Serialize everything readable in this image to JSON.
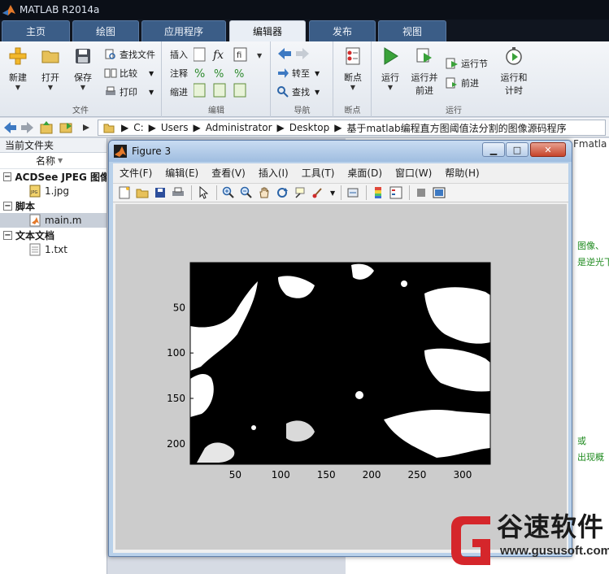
{
  "app": {
    "title": "MATLAB R2014a"
  },
  "tabs": [
    {
      "label": "主页"
    },
    {
      "label": "绘图"
    },
    {
      "label": "应用程序"
    },
    {
      "label": "编辑器",
      "active": true
    },
    {
      "label": "发布"
    },
    {
      "label": "视图"
    }
  ],
  "ribbon": {
    "file_group": {
      "label": "文件",
      "new": "新建",
      "open": "打开",
      "save": "保存",
      "find_files": "查找文件",
      "compare": "比较",
      "print": "打印"
    },
    "edit_group": {
      "label": "编辑",
      "insert": "插入",
      "comment": "注释",
      "indent": "缩进"
    },
    "nav_group": {
      "label": "导航",
      "goto": "转至",
      "find": "查找"
    },
    "bp_group": {
      "label": "断点",
      "breakpoints": "断点"
    },
    "run_group": {
      "label": "运行",
      "run": "运行",
      "run_advance_l1": "运行并",
      "run_advance_l2": "前进",
      "run_section": "运行节",
      "advance": "前进",
      "run_time_l1": "运行和",
      "run_time_l2": "计时"
    }
  },
  "address": {
    "segments": [
      "C:",
      "Users",
      "Administrator",
      "Desktop",
      "基于matlab编程直方图阈值法分割的图像源码程序"
    ]
  },
  "current_folder": {
    "title": "当前文件夹",
    "column_name": "名称",
    "groups": [
      {
        "label": "ACDSee JPEG 图像",
        "files": [
          {
            "name": "1.jpg",
            "icon": "jpeg-file-icon"
          }
        ]
      },
      {
        "label": "脚本",
        "files": [
          {
            "name": "main.m",
            "icon": "matlab-script-icon",
            "selected": true
          }
        ]
      },
      {
        "label": "文本文档",
        "files": [
          {
            "name": "1.txt",
            "icon": "text-file-icon"
          }
        ]
      }
    ]
  },
  "background_editor": {
    "tab_fragment": "Fmatla",
    "comment_1": "图像、",
    "comment_2": "是逆光下",
    "comment_3": "或",
    "comment_4": "出现概"
  },
  "figure": {
    "title": "Figure 3",
    "menu": [
      "文件(F)",
      "编辑(E)",
      "查看(V)",
      "插入(I)",
      "工具(T)",
      "桌面(D)",
      "窗口(W)",
      "帮助(H)"
    ],
    "toolbar_icons": [
      "new-figure-icon",
      "open-icon",
      "save-icon",
      "print-icon",
      "pointer-icon",
      "zoom-in-icon",
      "zoom-out-icon",
      "pan-icon",
      "rotate-icon",
      "data-cursor-icon",
      "brush-icon",
      "link-icon",
      "colorbar-icon",
      "legend-icon",
      "hide-plot-tools-icon",
      "show-plot-tools-icon"
    ],
    "axes": {
      "xticks": [
        "50",
        "100",
        "150",
        "200",
        "250",
        "300"
      ],
      "yticks": [
        "50",
        "100",
        "150",
        "200"
      ],
      "xlim": [
        0.5,
        330.5
      ],
      "ylim": [
        0.5,
        222.5
      ]
    }
  },
  "watermark": {
    "brand_cn": "谷速软件",
    "url": "www.gususoft.com"
  },
  "colors": {
    "ribbon_tab": "#3b5d87",
    "active_tab": "#e9eef5",
    "figure_bg": "#cccccc",
    "accent_red": "#d5262b"
  }
}
